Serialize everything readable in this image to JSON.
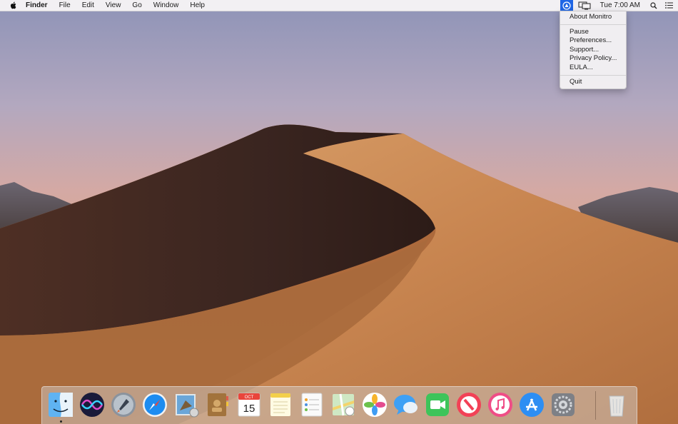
{
  "menubar": {
    "apple_icon": "apple-icon",
    "app_name": "Finder",
    "menus": [
      "File",
      "Edit",
      "View",
      "Go",
      "Window",
      "Help"
    ],
    "status_items": [
      "monitro-icon",
      "display-mirror-icon",
      "spotlight-icon",
      "notification-center-icon"
    ],
    "clock": "Tue 7:00 AM"
  },
  "monitro_menu": {
    "groups": [
      [
        "About Monitro"
      ],
      [
        "Pause",
        "Preferences...",
        "Support...",
        "Privacy Policy...",
        "EULA..."
      ],
      [
        "Quit"
      ]
    ]
  },
  "dock": {
    "apps": [
      "Finder",
      "Siri",
      "Launchpad",
      "Safari",
      "Mail",
      "Contacts",
      "Calendar",
      "Notes",
      "Reminders",
      "Maps",
      "Photos",
      "Messages",
      "FaceTime",
      "News",
      "iTunes",
      "App Store",
      "System Preferences"
    ],
    "trash": "Trash",
    "calendar_month": "OCT",
    "calendar_day": "15"
  },
  "colors": {
    "menu_highlight": "#1f66e5",
    "sky_top": "#8e93b7",
    "sky_horizon": "#d4a9a4",
    "dune_light": "#c98a54",
    "dune_shadow": "#3a2520"
  }
}
